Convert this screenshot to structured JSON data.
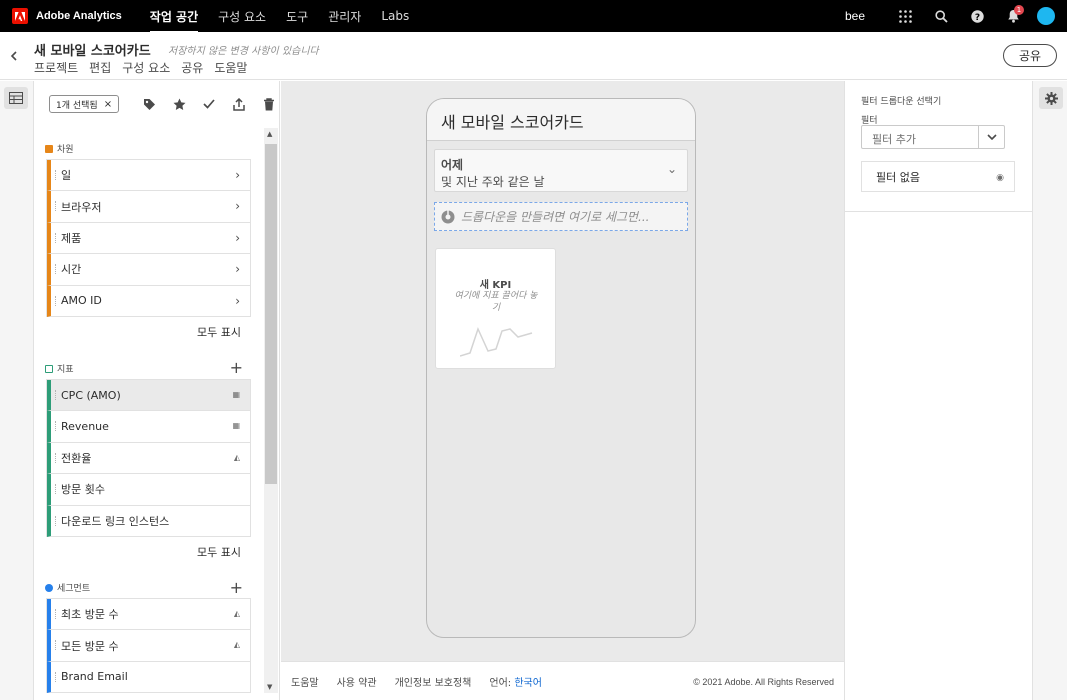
{
  "topnav": {
    "app_title": "Adobe Analytics",
    "items": [
      "작업 공간",
      "구성 요소",
      "도구",
      "관리자",
      "Labs"
    ],
    "active_index": 0,
    "user": "bee",
    "notification_count": "1"
  },
  "project": {
    "title": "새 모바일 스코어카드",
    "unsaved_note": "저장하지 않은 변경 사항이 있습니다",
    "menu": [
      "프로젝트",
      "편집",
      "구성 요소",
      "공유",
      "도움말"
    ],
    "share_label": "공유"
  },
  "panel": {
    "selected_chip": "1개 선택됨",
    "dimensions": {
      "header": "차원",
      "items": [
        "일",
        "브라우저",
        "제품",
        "시간",
        "AMO ID"
      ],
      "show_all": "모두 표시"
    },
    "metrics": {
      "header": "지표",
      "items": [
        "CPC (AMO)",
        "Revenue",
        "전환율",
        "방문 횟수",
        "다운로드 링크 인스턴스"
      ],
      "show_all": "모두 표시"
    },
    "segments": {
      "header": "세그먼트",
      "items": [
        "최초 방문 수",
        "모든 방문 수",
        "Brand Email"
      ]
    }
  },
  "canvas": {
    "scorecard_title": "새 모바일 스코어카드",
    "date_main": "어제",
    "date_sub": "및 지난 주와 같은 날",
    "drop_zone_text": "드롭다운을 만들려면 여기로 세그먼...",
    "kpi_title": "새 KPI",
    "kpi_sub": "여기에 지표 끌어다 놓기"
  },
  "footer": {
    "help": "도움말",
    "terms": "사용 약관",
    "privacy": "개인정보 보호정책",
    "language_label": "언어:",
    "language_value": "한국어",
    "copyright": "© 2021 Adobe. All Rights Reserved"
  },
  "settings": {
    "title": "필터 드롭다운 선택기",
    "filter_label": "필터",
    "filter_placeholder": "필터 추가",
    "no_filter": "필터 없음"
  },
  "colors": {
    "dimension": "#e68619",
    "metric": "#2d9d78",
    "segment": "#2680eb",
    "brand": "#eb1000"
  }
}
